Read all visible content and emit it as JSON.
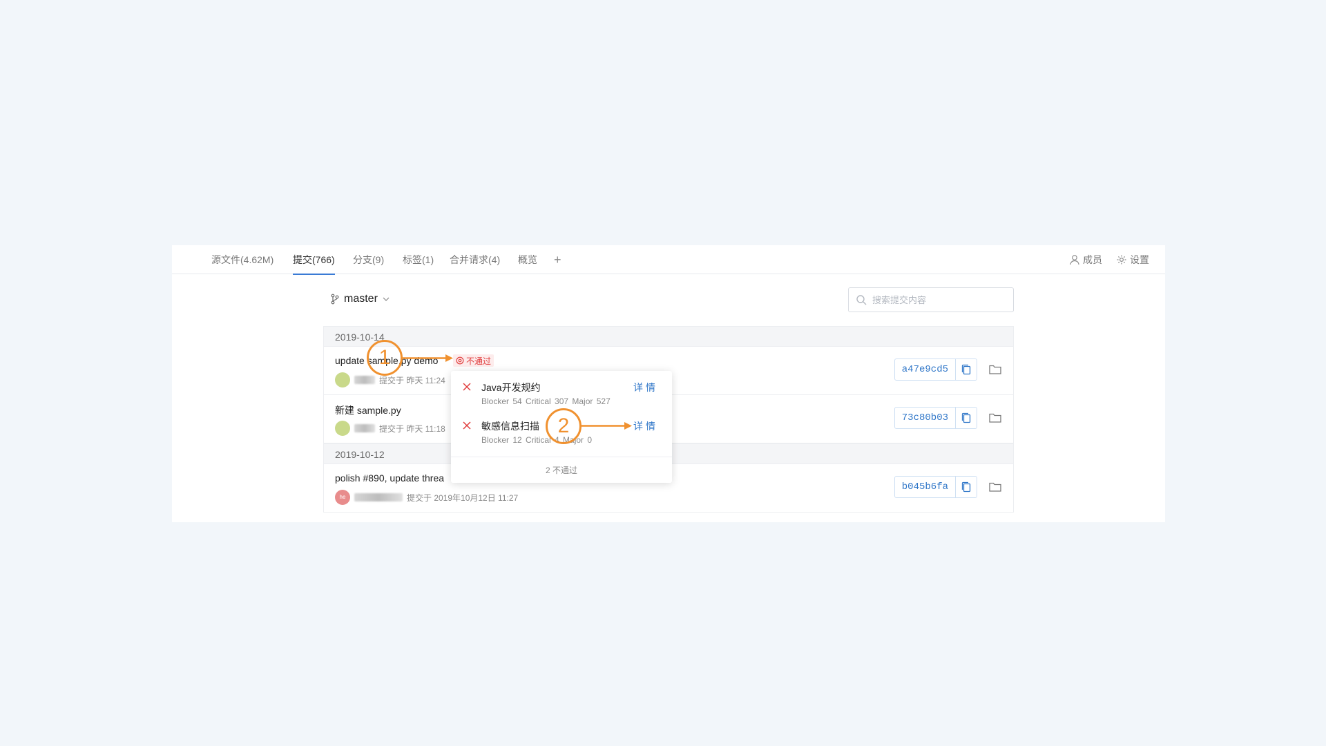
{
  "tabs": [
    {
      "label": "源文件(4.62M)"
    },
    {
      "label": "提交(766)"
    },
    {
      "label": "分支(9)"
    },
    {
      "label": "标签(1)"
    },
    {
      "label": "合并请求(4)"
    },
    {
      "label": "概览"
    }
  ],
  "tab_add": "+",
  "header_actions": {
    "members": "成员",
    "settings": "设置"
  },
  "branch": {
    "name": "master"
  },
  "search": {
    "placeholder": "搜索提交内容"
  },
  "groups": [
    {
      "date": "2019-10-14",
      "commits": [
        {
          "title": "update sample.py demo",
          "meta": "提交于 昨天 11:24",
          "hash": "a47e9cd5",
          "avatar_color": "#c9d98a"
        },
        {
          "title": "新建 sample.py",
          "meta": "提交于 昨天 11:18",
          "hash": "73c80b03",
          "avatar_color": "#c9d98a"
        }
      ]
    },
    {
      "date": "2019-10-12",
      "commits": [
        {
          "title": "polish #890, update threa",
          "meta": "提交于 2019年10月12日 11:27",
          "hash": "b045b6fa",
          "avatar_color": "#e88c8c",
          "avatar_text": "he"
        }
      ]
    }
  ],
  "fail_badge": {
    "label": "不通过",
    "color": "#e03c3c"
  },
  "popover": {
    "items": [
      {
        "title": "Java开发规约",
        "stats": "Blocker 54   Critical 307   Major 527",
        "link": "详情"
      },
      {
        "title": "敏感信息扫描",
        "stats": "Blocker 12   Critical 4   Major 0",
        "link": "详情"
      }
    ],
    "footer": "2 不通过"
  },
  "callouts": [
    "1",
    "2"
  ],
  "colors": {
    "accent": "#2f76c8",
    "callout": "#f0912f",
    "fail": "#e03c3c"
  }
}
